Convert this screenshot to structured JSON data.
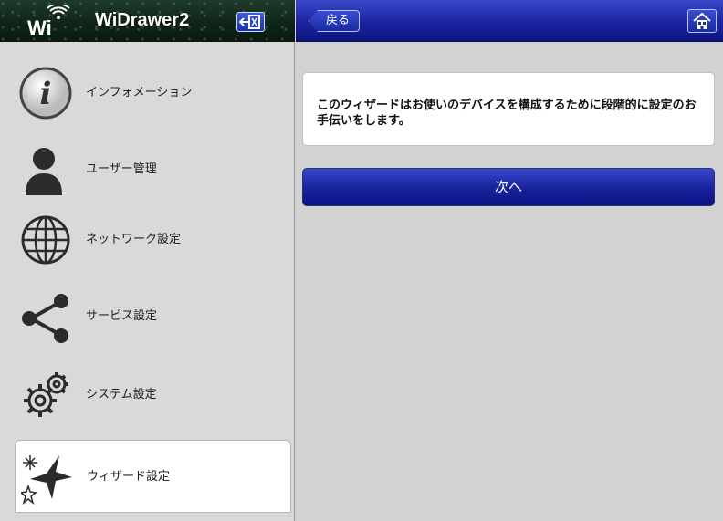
{
  "sidebar": {
    "title": "WiDrawer2",
    "logo_text": "Wi",
    "logout_icon": "logout-icon",
    "items": [
      {
        "label": "インフォメーション",
        "icon": "information-icon"
      },
      {
        "label": "ユーザー管理",
        "icon": "user-icon"
      },
      {
        "label": "ネットワーク設定",
        "icon": "globe-icon"
      },
      {
        "label": "サービス設定",
        "icon": "share-icon"
      },
      {
        "label": "システム設定",
        "icon": "gears-icon"
      },
      {
        "label": "ウィザード設定",
        "icon": "stars-icon",
        "active": true
      }
    ]
  },
  "topbar": {
    "back_label": "戻る",
    "home_icon": "home-icon"
  },
  "main": {
    "info_text": "このウィザードはお使いのデバイスを構成するために段階的に設定のお手伝いをします。",
    "next_label": "次へ"
  },
  "colors": {
    "accent": "#1c25a0",
    "sidebar_bg": "#d9d9d9",
    "content_bg": "#d2d2d2"
  }
}
